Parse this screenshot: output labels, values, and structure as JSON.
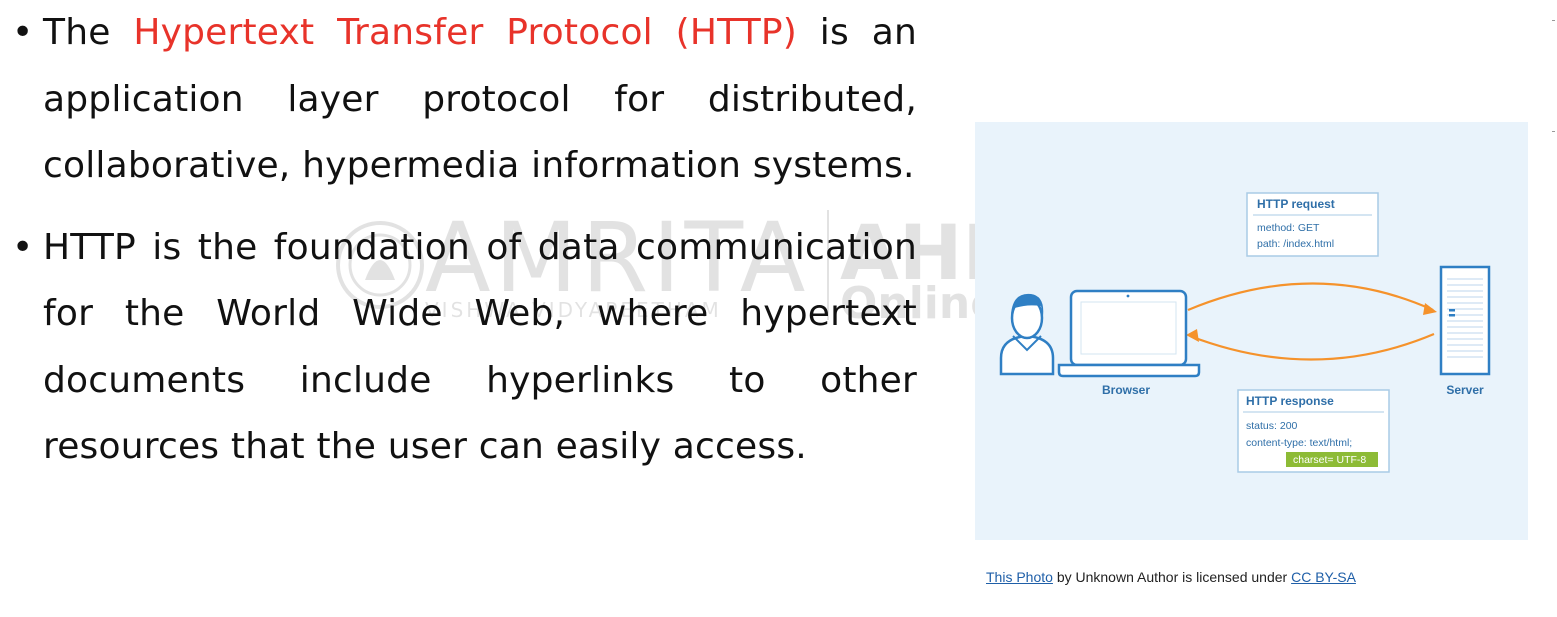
{
  "slide": {
    "bullet1": {
      "pre": "The ",
      "highlight": "Hypertext Transfer Protocol (HTTP)",
      "post": " is an application layer protocol for distributed, collaborative, hypermedia information systems."
    },
    "bullet2": "HTTP is the foundation of data communication for the World Wide Web, where hypertext documents include hyperlinks to other resources that the user can easily access.",
    "highlight_color": "#e8332a",
    "text_color": "#111111"
  },
  "watermark": {
    "name": "AMRITA",
    "tagline": "VISHWA VIDYAPEETHAM",
    "right_top": "AHEAD",
    "right_bottom": "Online"
  },
  "diagram": {
    "background": "#e9f3fb",
    "accent": "#2f7fc4",
    "arrow_color": "#f5922b",
    "browser_label": "Browser",
    "server_label": "Server",
    "request": {
      "title": "HTTP request",
      "line1": "method: GET",
      "line2": "path: /index.html"
    },
    "response": {
      "title": "HTTP response",
      "line1": "status: 200",
      "line2": "content-type: text/html;",
      "line3": "charset= UTF-8"
    }
  },
  "credit": {
    "link1": "This Photo",
    "middle": " by Unknown Author is licensed under ",
    "link2": "CC BY-SA"
  }
}
